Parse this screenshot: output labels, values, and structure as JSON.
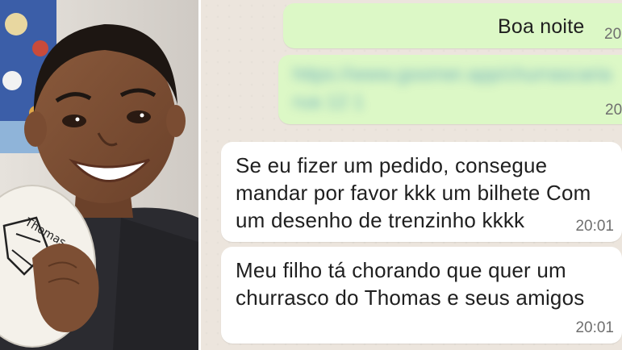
{
  "photo": {
    "subject": "smiling-boy-holding-drawn-plate",
    "plate_scribble": "Thomas"
  },
  "messages": [
    {
      "direction": "out",
      "text": "Boa noite",
      "time": "20:"
    },
    {
      "direction": "out",
      "text": "https://www.goomer.app/churrascaria\nrua 12 1",
      "time": "20:",
      "blurred": true
    },
    {
      "direction": "in",
      "text": "Se eu fizer um pedido, consegue\nmandar por favor kkk um bilhete Com\num desenho de trenzinho kkkk",
      "time": "20:01"
    },
    {
      "direction": "in",
      "text": "Meu filho tá chorando que quer um\nchurrasco do Thomas e seus amigos",
      "time": "20:01"
    }
  ],
  "colors": {
    "chat_background": "#ece5dd",
    "outgoing_bubble": "#dcf8c6",
    "incoming_bubble": "#ffffff",
    "timestamp": "#6f6f6f"
  }
}
